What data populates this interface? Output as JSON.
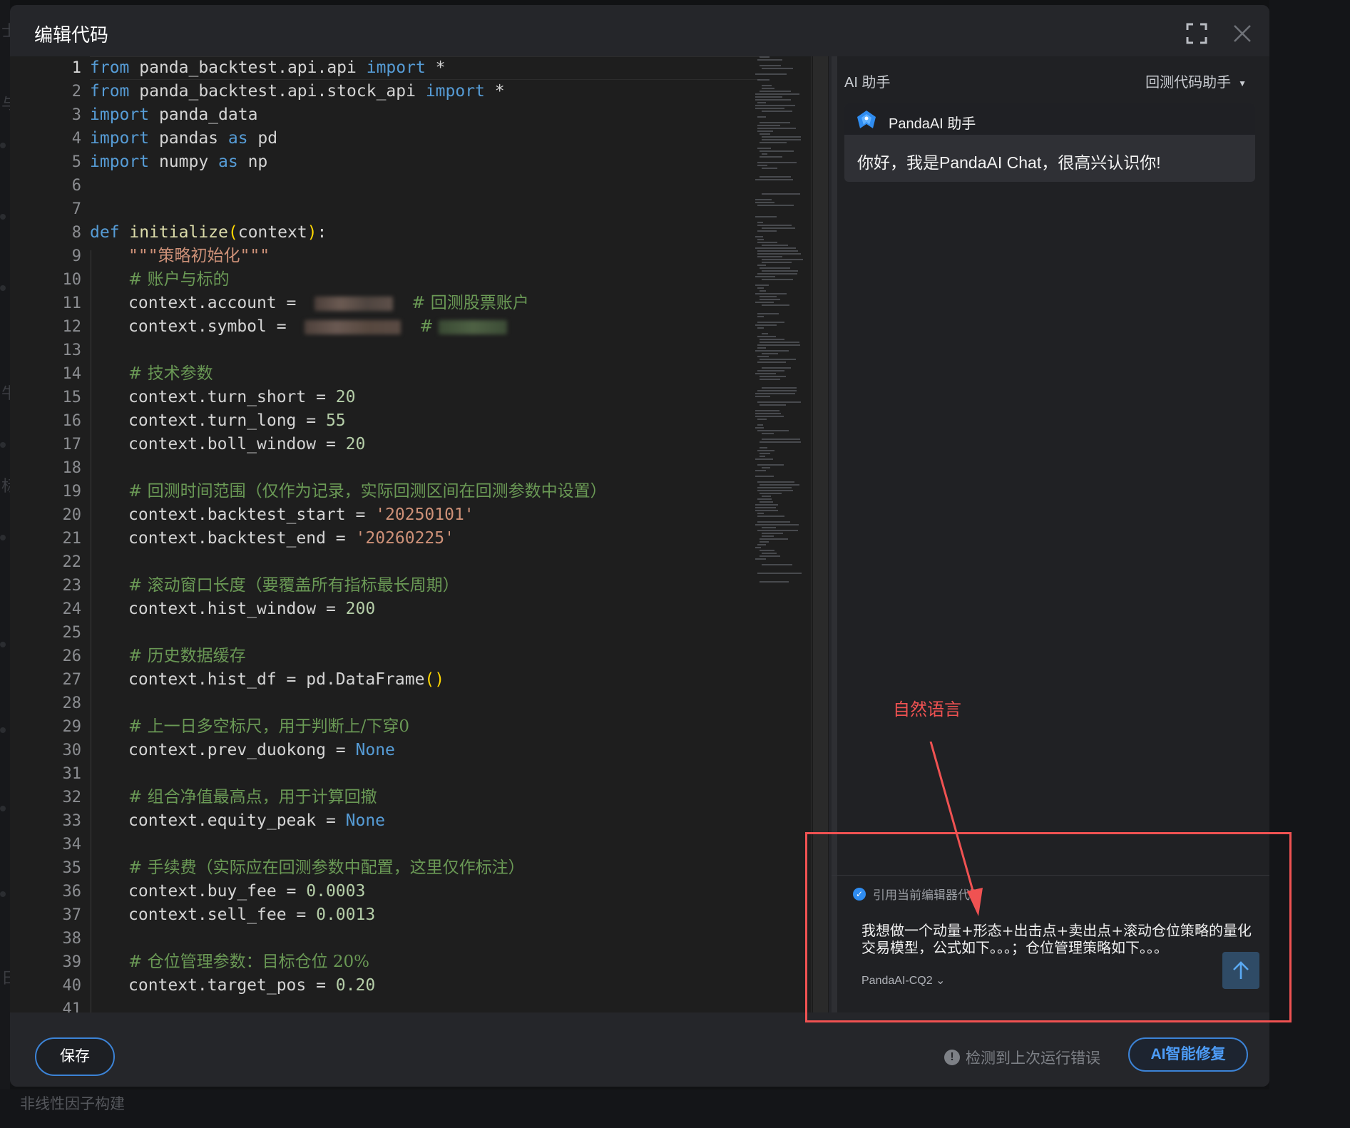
{
  "background": {
    "bottom_text": "非线性因子构建",
    "edge_fragments": [
      "士",
      "与",
      "牛",
      "标",
      "日"
    ]
  },
  "modal": {
    "title": "编辑代码",
    "fullscreen_icon": "expand-icon",
    "close_icon": "close-icon"
  },
  "editor": {
    "active_line": 1,
    "line_numbers": [
      "1",
      "2",
      "3",
      "4",
      "5",
      "6",
      "7",
      "8",
      "9",
      "10",
      "11",
      "12",
      "13",
      "14",
      "15",
      "16",
      "17",
      "18",
      "19",
      "20",
      "21",
      "22",
      "23",
      "24",
      "25",
      "26",
      "27",
      "28",
      "29",
      "30",
      "31",
      "32",
      "33",
      "34",
      "35",
      "36",
      "37",
      "38",
      "39",
      "40",
      "41"
    ],
    "code": {
      "l1": {
        "a": "from",
        "b": " panda_backtest.api.api ",
        "c": "import",
        "d": " *"
      },
      "l2": {
        "a": "from",
        "b": " panda_backtest.api.stock_api ",
        "c": "import",
        "d": " *"
      },
      "l3": {
        "a": "import",
        "b": " panda_data"
      },
      "l4": {
        "a": "import",
        "b": " pandas ",
        "c": "as",
        "d": " pd"
      },
      "l5": {
        "a": "import",
        "b": " numpy ",
        "c": "as",
        "d": " np"
      },
      "l8": {
        "a": "def",
        "b": " initialize",
        "c": "(",
        "d": "context",
        "e": ")",
        "f": ":"
      },
      "l9": {
        "a": "\"\"\"策略初始化\"\"\""
      },
      "l10": {
        "a": "# 账户与标的"
      },
      "l11": {
        "a": "context.account = ",
        "c": "# 回测股票账户"
      },
      "l12": {
        "a": "context.symbol = ",
        "c": "# "
      },
      "l14": {
        "a": "# 技术参数"
      },
      "l15": {
        "a": "context.turn_short = ",
        "b": "20"
      },
      "l16": {
        "a": "context.turn_long = ",
        "b": "55"
      },
      "l17": {
        "a": "context.boll_window = ",
        "b": "20"
      },
      "l19": {
        "a": "# 回测时间范围（仅作为记录，实际回测区间在回测参数中设置）"
      },
      "l20": {
        "a": "context.backtest_start = ",
        "b": "'20250101'"
      },
      "l21": {
        "a": "context.backtest_end = ",
        "b": "'20260225'"
      },
      "l23": {
        "a": "# 滚动窗口长度（要覆盖所有指标最长周期）"
      },
      "l24": {
        "a": "context.hist_window = ",
        "b": "200"
      },
      "l26": {
        "a": "# 历史数据缓存"
      },
      "l27": {
        "a": "context.hist_df = pd.DataFrame",
        "b": "()"
      },
      "l29": {
        "a": "# 上一日多空标尺，用于判断上/下穿0"
      },
      "l30": {
        "a": "context.prev_duokong = ",
        "b": "None"
      },
      "l32": {
        "a": "# 组合净值最高点，用于计算回撤"
      },
      "l33": {
        "a": "context.equity_peak = ",
        "b": "None"
      },
      "l35": {
        "a": "# 手续费（实际应在回测参数中配置，这里仅作标注）"
      },
      "l36": {
        "a": "context.buy_fee = ",
        "b": "0.0003"
      },
      "l37": {
        "a": "context.sell_fee = ",
        "b": "0.0013"
      },
      "l39": {
        "a": "# 仓位管理参数：目标仓位 20%"
      },
      "l40": {
        "a": "context.target_pos = ",
        "b": "0.20"
      }
    }
  },
  "ai_panel": {
    "title": "AI 助手",
    "mode_label": "回测代码助手",
    "assistant_name": "PandaAI 助手",
    "greeting": "你好，我是PandaAI Chat，很高兴认识你!",
    "cite_label": "引用当前编辑器代码",
    "cite_checked": true,
    "prompt_text": "我想做一个动量+形态+出击点+卖出点+滚动仓位策略的量化交易模型，公式如下。。。；仓位管理策略如下。。。",
    "model_label": "PandaAI-CQ2",
    "send_icon": "arrow-up-icon"
  },
  "footer": {
    "save_label": "保存",
    "error_note": "检测到上次运行错误",
    "fix_label": "AI智能修复"
  },
  "annotation": {
    "label": "自然语言",
    "color": "#f05252"
  },
  "colors": {
    "keyword": "#569cd6",
    "string": "#ce9178",
    "comment": "#6a9955",
    "number": "#b5cea8",
    "accent": "#3c83d6"
  }
}
